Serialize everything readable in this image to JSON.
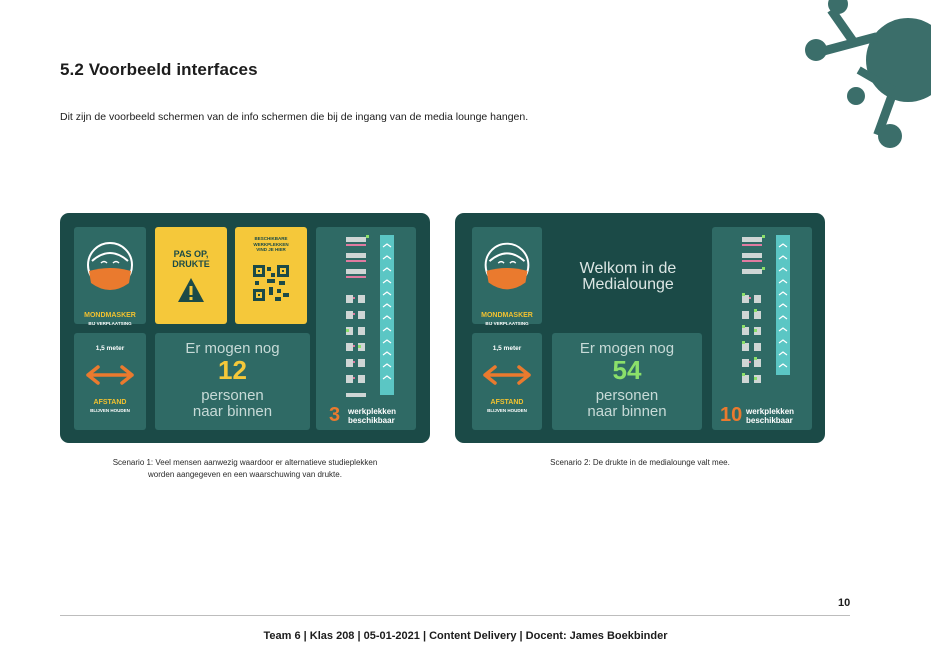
{
  "heading": "5.2 Voorbeeld interfaces",
  "intro": "Dit zijn de voorbeeld schermen van de info schermen die bij de ingang van de media lounge hangen.",
  "colors": {
    "screen_bg": "#1b4a47",
    "tile_bg": "#2f6a65",
    "yellow": "#f5c83a",
    "orange": "#ea7a2e",
    "green_count": "#8be06a",
    "cyan_bar": "#5bc6c4",
    "virus": "#3b6e6a"
  },
  "screens": [
    {
      "mask_label": "MONDMASKER",
      "mask_sub": "BIJ VERPLAATSING",
      "warning": [
        "PAS OP,",
        "DRUKTE"
      ],
      "qr_text": [
        "BESCHIKBARE",
        "WERKPLEKKEN",
        "VIND JE HIER"
      ],
      "distance_top": "1,5 meter",
      "distance_label": "AFSTAND",
      "distance_sub": "BLIJVEN HOUDEN",
      "count_top": "Er mogen nog",
      "count": "12",
      "count_bottom": [
        "personen",
        "naar binnen"
      ],
      "available": "3",
      "available_label": [
        "werkplekken",
        "beschikbaar"
      ],
      "caption": [
        "Scenario 1: Veel mensen aanwezig waardoor er alternatieve studieplekken",
        "worden aangegeven en een waarschuwing van drukte."
      ]
    },
    {
      "mask_label": "MONDMASKER",
      "mask_sub": "BIJ VERPLAATSING",
      "welcome": [
        "Welkom in de",
        "Medialounge"
      ],
      "distance_top": "1,5 meter",
      "distance_label": "AFSTAND",
      "distance_sub": "BLIJVEN HOUDEN",
      "count_top": "Er mogen nog",
      "count": "54",
      "count_bottom": [
        "personen",
        "naar binnen"
      ],
      "available": "10",
      "available_label": [
        "werkplekken",
        "beschikbaar"
      ],
      "caption": [
        "Scenario 2: De drukte in de medialounge valt mee."
      ]
    }
  ],
  "page_number": "10",
  "footer": "Team 6 | Klas 208 | 05-01-2021 | Content Delivery | Docent: James Boekbinder"
}
